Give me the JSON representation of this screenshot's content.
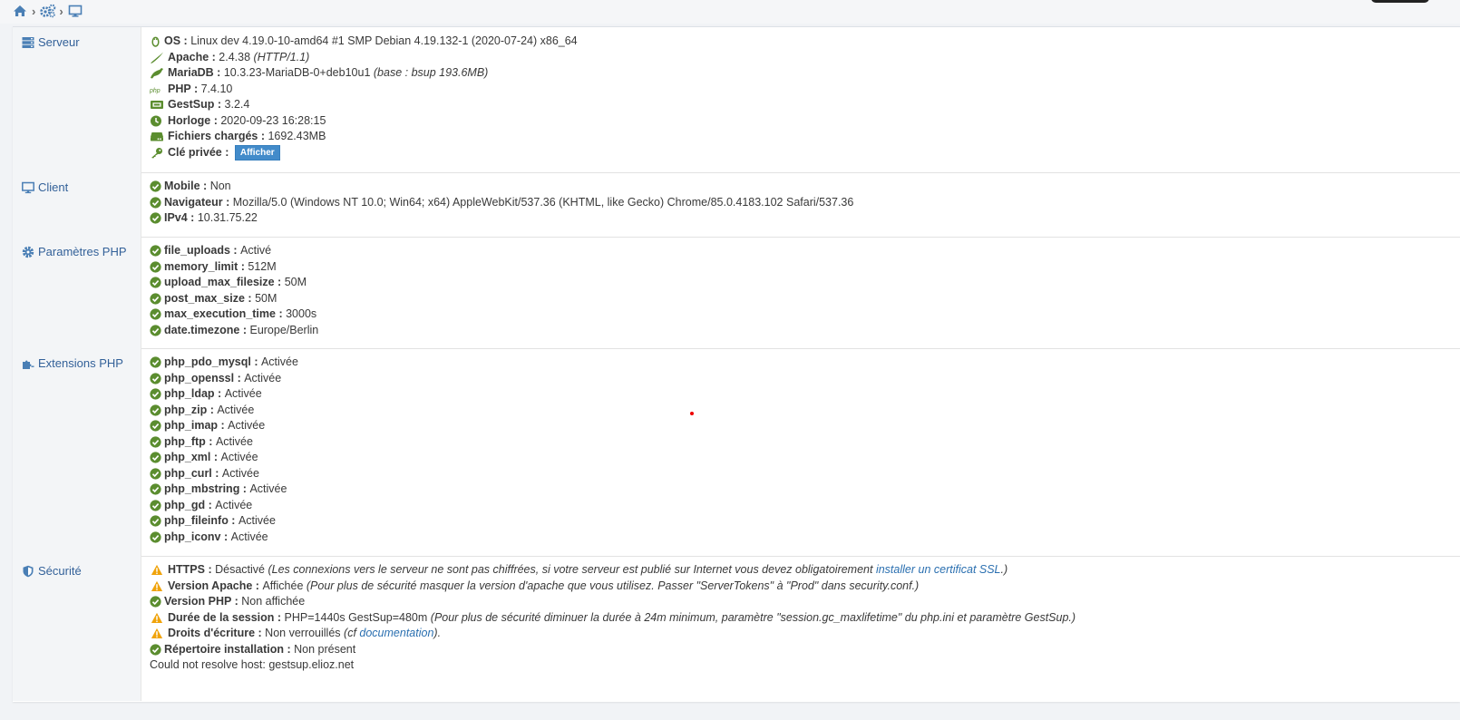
{
  "breadcrumb": {
    "home_icon": "home-icon",
    "system_icon": "cogs-icon",
    "page_icon": "desktop-icon"
  },
  "colors": {
    "label_text": "#336199",
    "check_green": "#5b8d2f",
    "warning_orange": "#f0a30a",
    "button_blue": "#428bca"
  },
  "sections": {
    "serveur": {
      "label": "Serveur",
      "os_key": "OS :",
      "os_val": "Linux dev 4.19.0-10-amd64 #1 SMP Debian 4.19.132-1 (2020-07-24) x86_64",
      "apache_key": "Apache :",
      "apache_val": "2.4.38",
      "apache_note": "(HTTP/1.1)",
      "mariadb_key": "MariaDB :",
      "mariadb_val": "10.3.23-MariaDB-0+deb10u1",
      "mariadb_note": "(base : bsup 193.6MB)",
      "php_key": "PHP :",
      "php_val": "7.4.10",
      "gestsup_key": "GestSup :",
      "gestsup_val": "3.2.4",
      "horloge_key": "Horloge :",
      "horloge_val": "2020-09-23 16:28:15",
      "fichiers_key": "Fichiers chargés :",
      "fichiers_val": "1692.43MB",
      "cle_key": "Clé privée :",
      "cle_button": "Afficher"
    },
    "client": {
      "label": "Client",
      "mobile_key": "Mobile :",
      "mobile_val": "Non",
      "nav_key": "Navigateur :",
      "nav_val": "Mozilla/5.0 (Windows NT 10.0; Win64; x64) AppleWebKit/537.36 (KHTML, like Gecko) Chrome/85.0.4183.102 Safari/537.36",
      "ip_key": "IPv4 :",
      "ip_val": "10.31.75.22"
    },
    "params": {
      "label": "Paramètres PHP",
      "items": [
        {
          "key": "file_uploads :",
          "val": "Activé"
        },
        {
          "key": "memory_limit :",
          "val": "512M"
        },
        {
          "key": "upload_max_filesize :",
          "val": "50M"
        },
        {
          "key": "post_max_size :",
          "val": "50M"
        },
        {
          "key": "max_execution_time :",
          "val": "3000s"
        },
        {
          "key": "date.timezone :",
          "val": "Europe/Berlin"
        }
      ]
    },
    "extensions": {
      "label": "Extensions PHP",
      "items": [
        {
          "key": "php_pdo_mysql :",
          "val": "Activée"
        },
        {
          "key": "php_openssl :",
          "val": "Activée"
        },
        {
          "key": "php_ldap :",
          "val": "Activée"
        },
        {
          "key": "php_zip :",
          "val": "Activée"
        },
        {
          "key": "php_imap :",
          "val": "Activée"
        },
        {
          "key": "php_ftp :",
          "val": "Activée"
        },
        {
          "key": "php_xml :",
          "val": "Activée"
        },
        {
          "key": "php_curl :",
          "val": "Activée"
        },
        {
          "key": "php_mbstring :",
          "val": "Activée"
        },
        {
          "key": "php_gd :",
          "val": "Activée"
        },
        {
          "key": "php_fileinfo :",
          "val": "Activée"
        },
        {
          "key": "php_iconv :",
          "val": "Activée"
        }
      ]
    },
    "securite": {
      "label": "Sécurité",
      "https_key": "HTTPS :",
      "https_val": "Désactivé",
      "https_note": "(Les connexions vers le serveur ne sont pas chiffrées, si votre serveur est publié sur Internet vous devez obligatoirement ",
      "https_link": "installer un certificat SSL",
      "https_end": ".)",
      "apache_key": "Version Apache :",
      "apache_val": "Affichée",
      "apache_note": "(Pour plus de sécurité masquer la version d'apache que vous utilisez. Passer \"ServerTokens\" à \"Prod\" dans security.conf.)",
      "phpver_key": "Version PHP :",
      "phpver_val": "Non affichée",
      "session_key": "Durée de la session :",
      "session_val": "PHP=1440s GestSup=480m",
      "session_note": "(Pour plus de sécurité diminuer la durée à 24m minimum, paramètre \"session.gc_maxlifetime\" du php.ini et paramètre GestSup.)",
      "droits_key": "Droits d'écriture :",
      "droits_val": "Non verrouillés",
      "droits_open": "(cf ",
      "droits_link": "documentation",
      "droits_close": ").",
      "rep_key": "Répertoire installation :",
      "rep_val": "Non présent",
      "resolve_msg": "Could not resolve host: gestsup.elioz.net"
    }
  }
}
